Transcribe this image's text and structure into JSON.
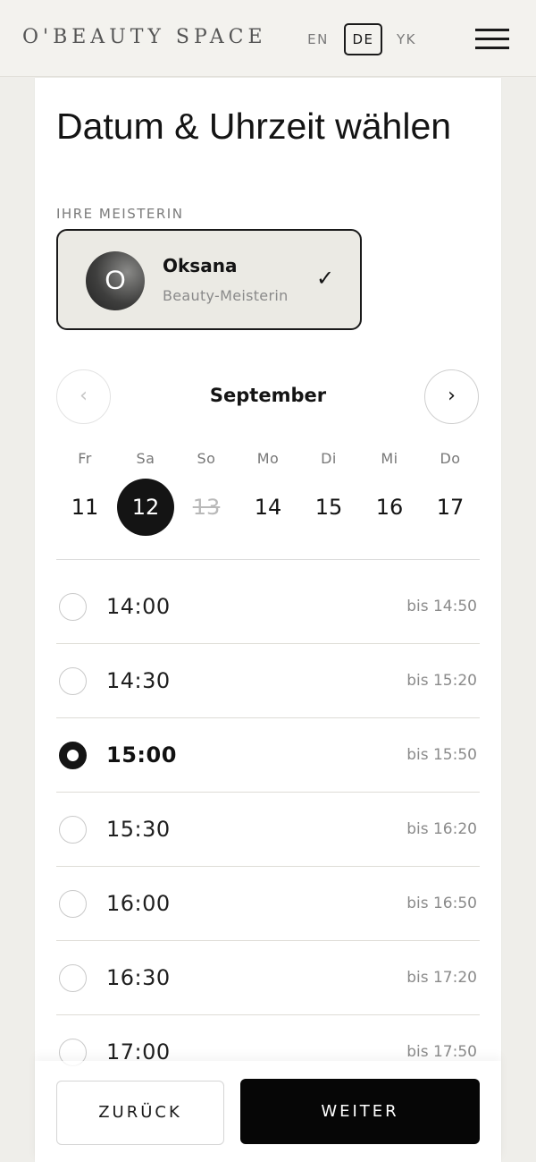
{
  "header": {
    "logo": "O'BEAUTY SPACE",
    "languages": [
      "EN",
      "DE",
      "YK"
    ],
    "active_language": "DE",
    "menu_icon": "hamburger-menu-icon"
  },
  "page": {
    "title": "Datum & Uhrzeit wählen"
  },
  "master_section": {
    "label": "IHRE MEISTERIN",
    "avatar_initial": "O",
    "name": "Oksana",
    "role": "Beauty-Meisterin",
    "check_symbol": "✓"
  },
  "calendar": {
    "month": "September",
    "prev_symbol": "‹",
    "next_symbol": "›",
    "days": [
      {
        "weekday": "Fr",
        "day": "11",
        "state": "available"
      },
      {
        "weekday": "Sa",
        "day": "12",
        "state": "selected"
      },
      {
        "weekday": "So",
        "day": "13",
        "state": "disabled"
      },
      {
        "weekday": "Mo",
        "day": "14",
        "state": "available"
      },
      {
        "weekday": "Di",
        "day": "15",
        "state": "available"
      },
      {
        "weekday": "Mi",
        "day": "16",
        "state": "available"
      },
      {
        "weekday": "Do",
        "day": "17",
        "state": "available"
      }
    ]
  },
  "time_slots": [
    {
      "time": "14:00",
      "until": "bis 14:50",
      "selected": false
    },
    {
      "time": "14:30",
      "until": "bis 15:20",
      "selected": false
    },
    {
      "time": "15:00",
      "until": "bis 15:50",
      "selected": true
    },
    {
      "time": "15:30",
      "until": "bis 16:20",
      "selected": false
    },
    {
      "time": "16:00",
      "until": "bis 16:50",
      "selected": false
    },
    {
      "time": "16:30",
      "until": "bis 17:20",
      "selected": false
    },
    {
      "time": "17:00",
      "until": "bis 17:50",
      "selected": false
    }
  ],
  "actions": {
    "back_label": "ZURÜCK",
    "next_label": "WEITER"
  },
  "colors": {
    "background": "#efeeea",
    "card": "#ffffff",
    "accent": "#141414",
    "master_card": "#ebeae4",
    "muted_text": "#8a8a8a"
  }
}
